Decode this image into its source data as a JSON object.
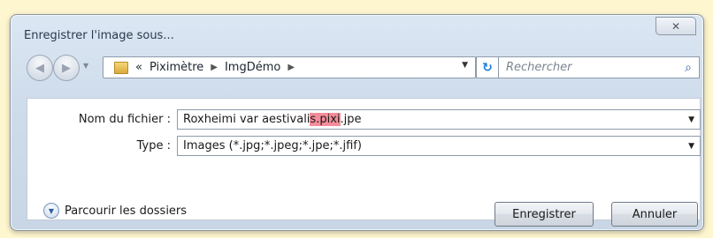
{
  "window": {
    "title": "Enregistrer l'image sous...",
    "close_glyph": "✕"
  },
  "nav": {
    "back_icon": "back-arrow-icon",
    "forward_icon": "forward-arrow-icon",
    "chevrons": "«",
    "breadcrumb": [
      "Piximètre",
      "ImgDémo"
    ],
    "search_placeholder": "Rechercher"
  },
  "form": {
    "filename_label": "Nom du fichier :",
    "filename_prefix": "Roxheimi var aestivali",
    "filename_highlight": "s.pixi",
    "filename_suffix": ".jpe",
    "type_label": "Type :",
    "type_value": "Images  (*.jpg;*.jpeg;*.jpe;*.jfif)"
  },
  "footer": {
    "browse_label": "Parcourir les dossiers",
    "save_label": "Enregistrer",
    "cancel_label": "Annuler"
  },
  "colors": {
    "highlight": "#f58c9a",
    "background": "#fdf6cf"
  }
}
